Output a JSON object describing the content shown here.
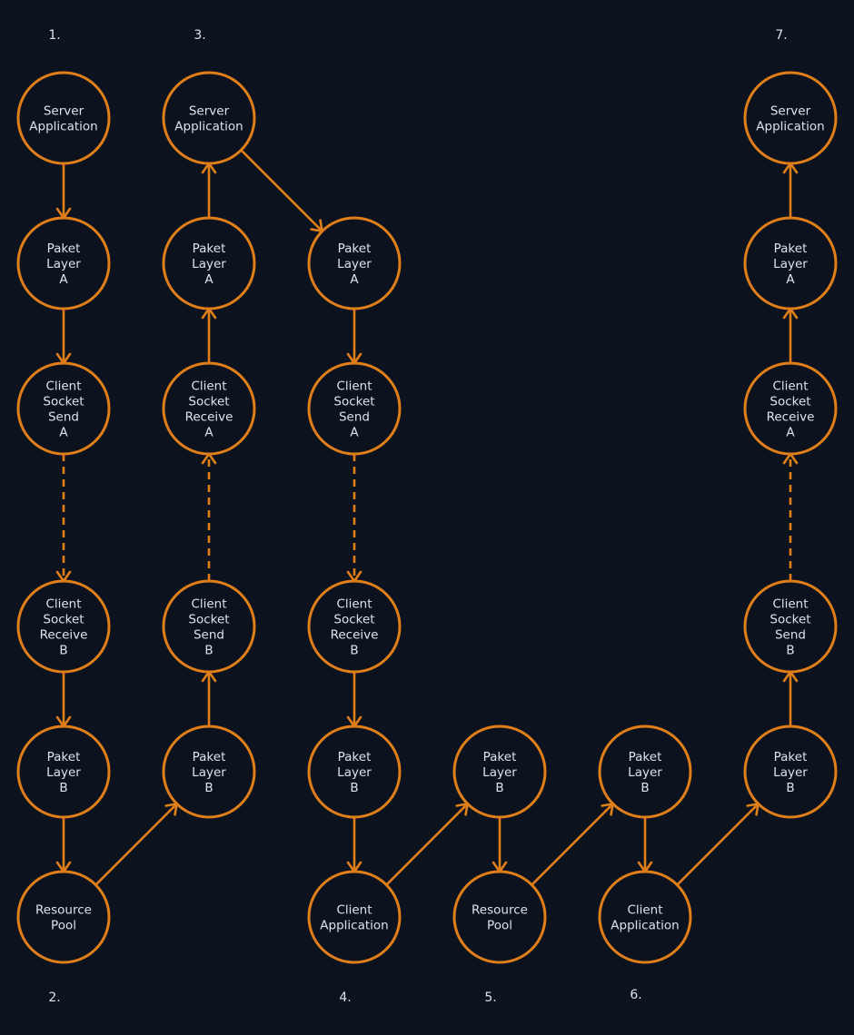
{
  "diagram": {
    "title": "",
    "colors": {
      "background": "#0d131e",
      "accent": "#e07f1a",
      "text": "#dde3ea"
    },
    "step_labels": [
      {
        "id": "s1",
        "text": "1.",
        "col": 0,
        "pos": "top"
      },
      {
        "id": "s3",
        "text": "3.",
        "col": 1,
        "pos": "top"
      },
      {
        "id": "s7",
        "text": "7.",
        "col": 5,
        "pos": "top"
      },
      {
        "id": "s2",
        "text": "2.",
        "col": 0,
        "pos": "bottom"
      },
      {
        "id": "s4",
        "text": "4.",
        "col": 2,
        "pos": "bottom"
      },
      {
        "id": "s5",
        "text": "5.",
        "col": 3,
        "pos": "bottom"
      },
      {
        "id": "s6",
        "text": "6.",
        "col": 4,
        "pos": "bottom"
      }
    ],
    "nodes": [
      {
        "id": "c0r0",
        "col": 0,
        "row": 0,
        "lines": [
          "Server",
          "Application"
        ]
      },
      {
        "id": "c0r1",
        "col": 0,
        "row": 1,
        "lines": [
          "Paket",
          "Layer",
          "A"
        ]
      },
      {
        "id": "c0r2",
        "col": 0,
        "row": 2,
        "lines": [
          "Client",
          "Socket",
          "Send",
          "A"
        ]
      },
      {
        "id": "c0r3",
        "col": 0,
        "row": 3,
        "lines": [
          "Client",
          "Socket",
          "Receive",
          "B"
        ]
      },
      {
        "id": "c0r4",
        "col": 0,
        "row": 4,
        "lines": [
          "Paket",
          "Layer",
          "B"
        ]
      },
      {
        "id": "c0r5",
        "col": 0,
        "row": 5,
        "lines": [
          "Resource",
          "Pool"
        ]
      },
      {
        "id": "c1r0",
        "col": 1,
        "row": 0,
        "lines": [
          "Server",
          "Application"
        ]
      },
      {
        "id": "c1r1",
        "col": 1,
        "row": 1,
        "lines": [
          "Paket",
          "Layer",
          "A"
        ]
      },
      {
        "id": "c1r2",
        "col": 1,
        "row": 2,
        "lines": [
          "Client",
          "Socket",
          "Receive",
          "A"
        ]
      },
      {
        "id": "c1r3",
        "col": 1,
        "row": 3,
        "lines": [
          "Client",
          "Socket",
          "Send",
          "B"
        ]
      },
      {
        "id": "c1r4",
        "col": 1,
        "row": 4,
        "lines": [
          "Paket",
          "Layer",
          "B"
        ]
      },
      {
        "id": "c2r1",
        "col": 2,
        "row": 1,
        "lines": [
          "Paket",
          "Layer",
          "A"
        ]
      },
      {
        "id": "c2r2",
        "col": 2,
        "row": 2,
        "lines": [
          "Client",
          "Socket",
          "Send",
          "A"
        ]
      },
      {
        "id": "c2r3",
        "col": 2,
        "row": 3,
        "lines": [
          "Client",
          "Socket",
          "Receive",
          "B"
        ]
      },
      {
        "id": "c2r4",
        "col": 2,
        "row": 4,
        "lines": [
          "Paket",
          "Layer",
          "B"
        ]
      },
      {
        "id": "c2r5",
        "col": 2,
        "row": 5,
        "lines": [
          "Client",
          "Application"
        ]
      },
      {
        "id": "c3r4",
        "col": 3,
        "row": 4,
        "lines": [
          "Paket",
          "Layer",
          "B"
        ]
      },
      {
        "id": "c3r5",
        "col": 3,
        "row": 5,
        "lines": [
          "Resource",
          "Pool"
        ]
      },
      {
        "id": "c4r4",
        "col": 4,
        "row": 4,
        "lines": [
          "Paket",
          "Layer",
          "B"
        ]
      },
      {
        "id": "c4r5",
        "col": 4,
        "row": 5,
        "lines": [
          "Client",
          "Application"
        ]
      },
      {
        "id": "c5r0",
        "col": 5,
        "row": 0,
        "lines": [
          "Server",
          "Application"
        ]
      },
      {
        "id": "c5r1",
        "col": 5,
        "row": 1,
        "lines": [
          "Paket",
          "Layer",
          "A"
        ]
      },
      {
        "id": "c5r2",
        "col": 5,
        "row": 2,
        "lines": [
          "Client",
          "Socket",
          "Receive",
          "A"
        ]
      },
      {
        "id": "c5r3",
        "col": 5,
        "row": 3,
        "lines": [
          "Client",
          "Socket",
          "Send",
          "B"
        ]
      },
      {
        "id": "c5r4",
        "col": 5,
        "row": 4,
        "lines": [
          "Paket",
          "Layer",
          "B"
        ]
      }
    ],
    "edges": [
      {
        "from": "c0r0",
        "to": "c0r1",
        "style": "solid"
      },
      {
        "from": "c0r1",
        "to": "c0r2",
        "style": "solid"
      },
      {
        "from": "c0r2",
        "to": "c0r3",
        "style": "dashed"
      },
      {
        "from": "c0r3",
        "to": "c0r4",
        "style": "solid"
      },
      {
        "from": "c0r4",
        "to": "c0r5",
        "style": "solid"
      },
      {
        "from": "c0r5",
        "to": "c1r4",
        "style": "solid"
      },
      {
        "from": "c1r4",
        "to": "c1r3",
        "style": "solid"
      },
      {
        "from": "c1r3",
        "to": "c1r2",
        "style": "dashed"
      },
      {
        "from": "c1r2",
        "to": "c1r1",
        "style": "solid"
      },
      {
        "from": "c1r1",
        "to": "c1r0",
        "style": "solid"
      },
      {
        "from": "c1r0",
        "to": "c2r1",
        "style": "solid"
      },
      {
        "from": "c2r1",
        "to": "c2r2",
        "style": "solid"
      },
      {
        "from": "c2r2",
        "to": "c2r3",
        "style": "dashed"
      },
      {
        "from": "c2r3",
        "to": "c2r4",
        "style": "solid"
      },
      {
        "from": "c2r4",
        "to": "c2r5",
        "style": "solid"
      },
      {
        "from": "c2r5",
        "to": "c3r4",
        "style": "solid"
      },
      {
        "from": "c3r4",
        "to": "c3r5",
        "style": "solid"
      },
      {
        "from": "c3r5",
        "to": "c4r4",
        "style": "solid"
      },
      {
        "from": "c4r4",
        "to": "c4r5",
        "style": "solid"
      },
      {
        "from": "c4r5",
        "to": "c5r4",
        "style": "solid"
      },
      {
        "from": "c5r4",
        "to": "c5r3",
        "style": "solid"
      },
      {
        "from": "c5r3",
        "to": "c5r2",
        "style": "dashed"
      },
      {
        "from": "c5r2",
        "to": "c5r1",
        "style": "solid"
      },
      {
        "from": "c5r1",
        "to": "c5r0",
        "style": "solid"
      }
    ]
  }
}
